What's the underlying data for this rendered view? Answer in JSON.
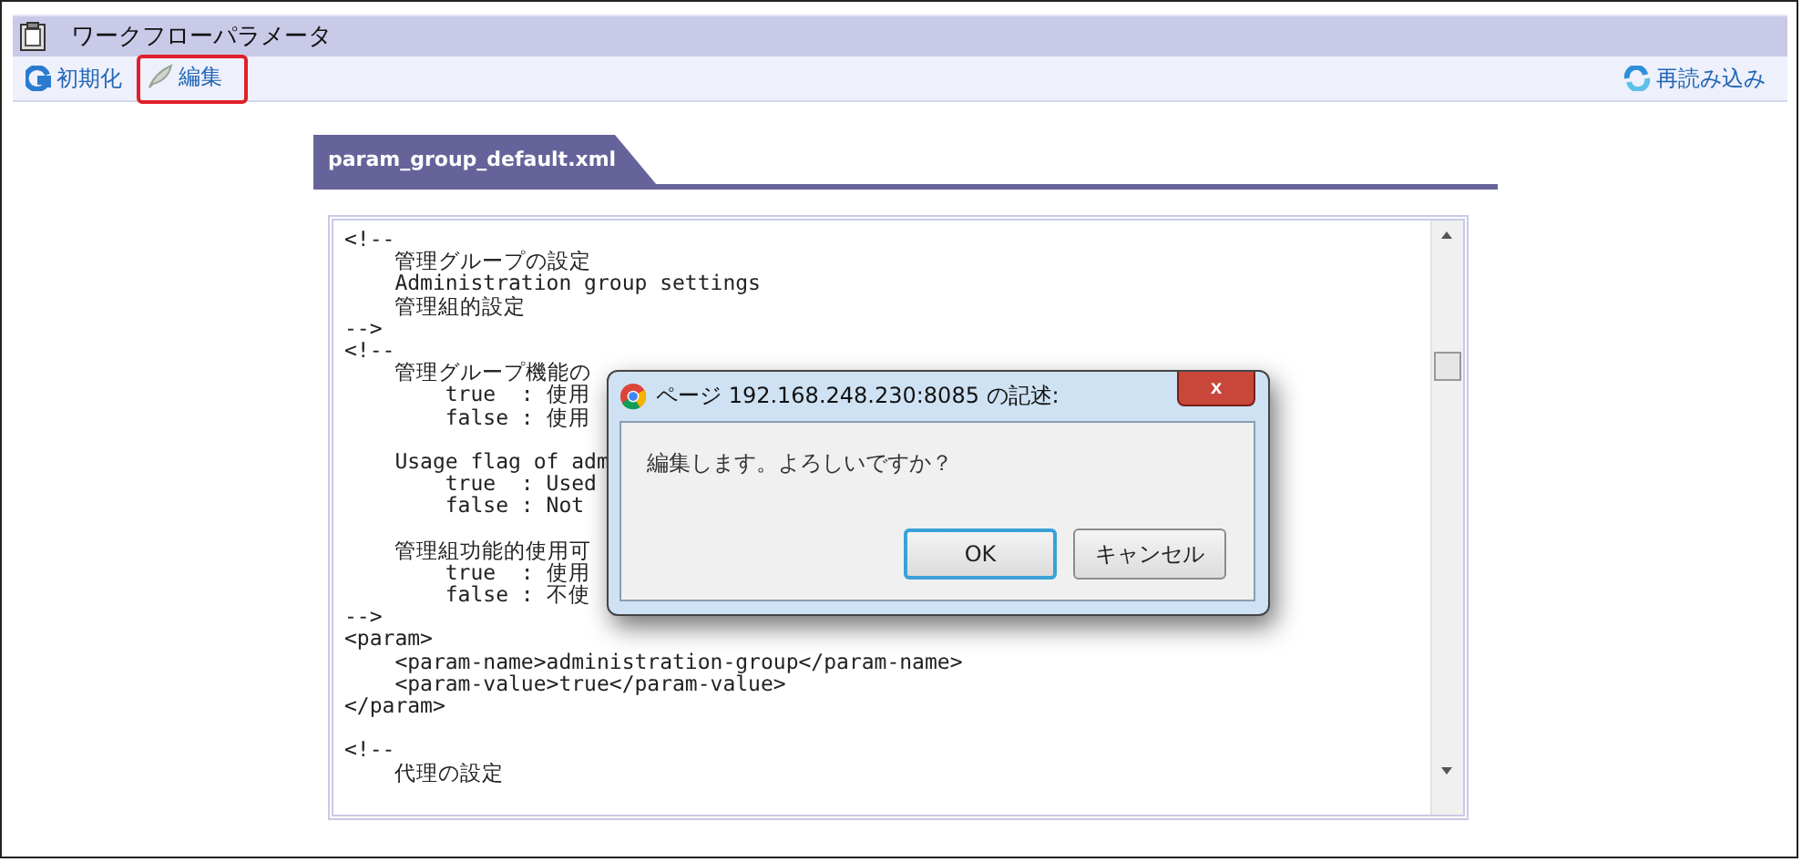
{
  "window": {
    "title": "ワークフローパラメータ"
  },
  "toolbar": {
    "items": [
      {
        "label": "初期化",
        "kind": "reset",
        "highlighted": false
      },
      {
        "label": "編集",
        "kind": "edit",
        "highlighted": true
      }
    ],
    "right": {
      "label": "再読み込み",
      "kind": "reload"
    }
  },
  "tabs": [
    {
      "label": "param_group_default.xml",
      "selected": true
    }
  ],
  "editor": {
    "lines": [
      {
        "kind": "text",
        "text": "<!--"
      },
      {
        "kind": "text",
        "text": "    管理グループの設定"
      },
      {
        "kind": "text",
        "text": "    Administration group settings"
      },
      {
        "kind": "text",
        "text": "    管理組的設定"
      },
      {
        "kind": "text",
        "text": "-->"
      },
      {
        "kind": "text",
        "text": "<!--"
      },
      {
        "kind": "text",
        "text": "    管理グループ機能の"
      },
      {
        "kind": "text",
        "text": "        true  : 使用"
      },
      {
        "kind": "text",
        "text": "        false : 使用"
      },
      {
        "kind": "blank"
      },
      {
        "kind": "text",
        "text": "    Usage flag of adm"
      },
      {
        "kind": "text",
        "text": "        true  : Used"
      },
      {
        "kind": "text",
        "text": "        false : Not"
      },
      {
        "kind": "blank"
      },
      {
        "kind": "text",
        "text": "    管理組功能的使用可"
      },
      {
        "kind": "text",
        "text": "        true  : 使用"
      },
      {
        "kind": "text",
        "text": "        false : 不使"
      },
      {
        "kind": "text",
        "text": "-->"
      },
      {
        "kind": "text",
        "text": "<param>"
      },
      {
        "kind": "text",
        "text": "    <param-name>administration-group</param-name>"
      },
      {
        "kind": "text",
        "text": "    <param-value>true</param-value>"
      },
      {
        "kind": "text",
        "text": "</param>"
      },
      {
        "kind": "blank"
      },
      {
        "kind": "text",
        "text": "<!--"
      },
      {
        "kind": "text",
        "text": "    代理の設定"
      }
    ]
  },
  "dialog": {
    "title": "ページ 192.168.248.230:8085 の記述:",
    "close": "x",
    "message": "編集します。よろしいですか？",
    "buttons": [
      {
        "label": "OK",
        "focused": true
      },
      {
        "label": "キャンセル",
        "focused": false
      }
    ]
  }
}
